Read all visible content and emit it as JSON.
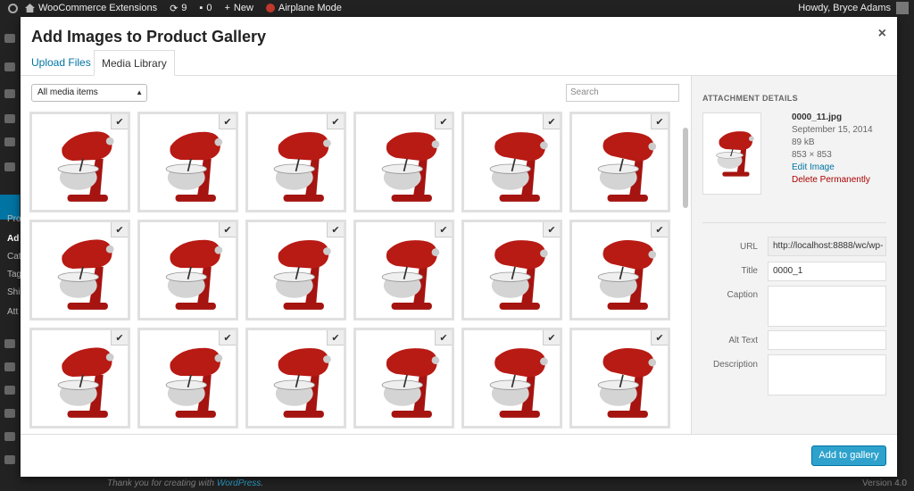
{
  "adminbar": {
    "site_name": "WooCommerce Extensions",
    "updates_count": "9",
    "comments_count": "0",
    "new_label": "New",
    "airplane_mode_label": "Airplane Mode",
    "greeting": "Howdy, Bryce Adams"
  },
  "leftmenu": {
    "partial_labels": [
      "Pro",
      "Ad",
      "Cat",
      "Tag",
      "Shi",
      "Att"
    ]
  },
  "footer": {
    "thanks_text": "Thank you for creating with",
    "wp_link": "WordPress",
    "version": "Version 4.0"
  },
  "modal": {
    "title": "Add Images to Product Gallery",
    "close_glyph": "×",
    "tabs": [
      {
        "label": "Upload Files"
      },
      {
        "label": "Media Library"
      }
    ],
    "filter_selected": "All media items",
    "search_placeholder": "Search",
    "check_glyph": "✔",
    "add_button_label": "Add to gallery"
  },
  "attachment": {
    "heading": "ATTACHMENT DETAILS",
    "filename": "0000_11.jpg",
    "date": "September 15, 2014",
    "size": "89 kB",
    "dimensions": "853 × 853",
    "edit_link": "Edit Image",
    "delete_link": "Delete Permanently",
    "fields": {
      "url_label": "URL",
      "url_value": "http://localhost:8888/wc/wp-",
      "title_label": "Title",
      "title_value": "0000_1",
      "caption_label": "Caption",
      "caption_value": "",
      "alt_label": "Alt Text",
      "alt_value": "",
      "description_label": "Description",
      "description_value": ""
    }
  },
  "colors": {
    "accent": "#0074a2",
    "button": "#2ea2cc",
    "mixer_red": "#a51410",
    "delete_red": "#aa0000"
  },
  "grid": {
    "columns": 6,
    "rows": 3,
    "all_selected": true,
    "thumbnail_icon": "stand-mixer-image"
  }
}
